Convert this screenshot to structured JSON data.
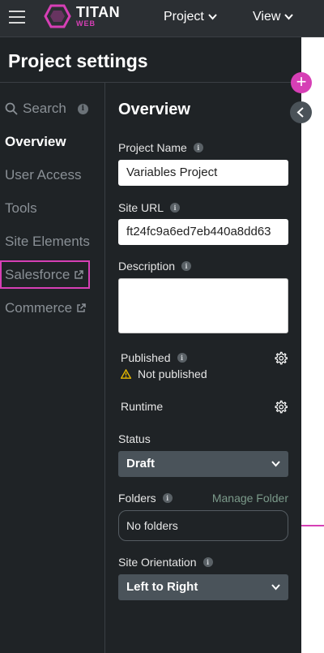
{
  "app": {
    "brand": "TITAN",
    "brand_sub": "WEB",
    "accent": "#d63fb5"
  },
  "topbar": {
    "project_menu": "Project",
    "view_menu": "View"
  },
  "page": {
    "title": "Project settings"
  },
  "sidebar": {
    "search_label": "Search",
    "items": [
      {
        "label": "Overview",
        "active": true
      },
      {
        "label": "User Access"
      },
      {
        "label": "Tools"
      },
      {
        "label": "Site Elements"
      },
      {
        "label": "Salesforce",
        "external": true
      },
      {
        "label": "Commerce",
        "external": true
      }
    ]
  },
  "overview": {
    "title": "Overview",
    "project_name_label": "Project Name",
    "project_name_value": "Variables Project",
    "site_url_label": "Site URL",
    "site_url_value": "ft24fc9a6ed7eb440a8dd63",
    "description_label": "Description",
    "description_value": "",
    "published_label": "Published",
    "published_status": "Not published",
    "runtime_label": "Runtime",
    "status_label": "Status",
    "status_value": "Draft",
    "folders_label": "Folders",
    "manage_folder": "Manage Folder",
    "folders_value": "No folders",
    "orientation_label": "Site Orientation",
    "orientation_value": "Left to Right"
  },
  "icons": {
    "info": "i",
    "plus": "+"
  }
}
